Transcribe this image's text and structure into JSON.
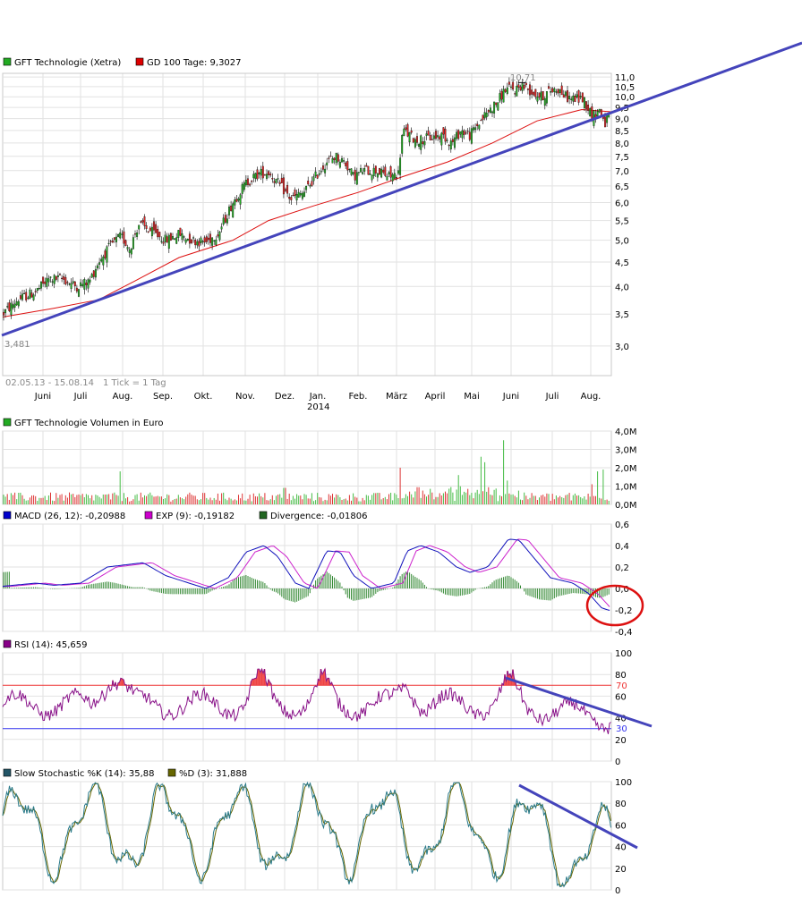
{
  "price_panel": {
    "legend": [
      {
        "label": "GFT Technologie (Xetra)",
        "color": "#22aa22"
      },
      {
        "label": "GD 100 Tage: 9,3027",
        "color": "#dd0000"
      }
    ],
    "yticks": [
      "11,0",
      "10,5",
      "10,0",
      "9,5",
      "9,0",
      "8,5",
      "8,0",
      "7,5",
      "7,0",
      "6,5",
      "6,0",
      "5,5",
      "5,0",
      "4,5",
      "4,0",
      "3,5",
      "3,0"
    ],
    "ytick_values": [
      11,
      10.5,
      10,
      9.5,
      9,
      8.5,
      8,
      7.5,
      7,
      6.5,
      6,
      5.5,
      5,
      4.5,
      4,
      3.5,
      3
    ],
    "high_label": "10,71",
    "low_label": "3,481",
    "date_range": "02.05.13 - 15.08.14",
    "tick_info": "1 Tick = 1 Tag",
    "months": [
      "Juni",
      "Juli",
      "Aug.",
      "Sep.",
      "Okt.",
      "Nov.",
      "Dez.",
      "Jan.",
      "Feb.",
      "März",
      "April",
      "Mai",
      "Juni",
      "Juli",
      "Aug."
    ],
    "year_label": "2014"
  },
  "volume_panel": {
    "legend": [
      {
        "label": "GFT Technologie Volumen in Euro",
        "color": "#22aa22"
      }
    ],
    "yticks": [
      "4,0M",
      "3,0M",
      "2,0M",
      "1,0M",
      "0,0M"
    ]
  },
  "macd_panel": {
    "legend": [
      {
        "label": "MACD (26, 12): -0,20988",
        "color": "#0000cc"
      },
      {
        "label": "EXP (9): -0,19182",
        "color": "#cc00cc"
      },
      {
        "label": "Divergence: -0,01806",
        "color": "#226622"
      }
    ],
    "yticks": [
      "0,6",
      "0,4",
      "0,2",
      "0,0",
      "-0,2",
      "-0,4"
    ]
  },
  "rsi_panel": {
    "legend": [
      {
        "label": "RSI (14): 45,659",
        "color": "#880088"
      }
    ],
    "yticks": [
      "100",
      "80",
      "60",
      "40",
      "20",
      "0"
    ],
    "level_70": "70",
    "level_30": "30"
  },
  "stoch_panel": {
    "legend": [
      {
        "label": "Slow Stochastic %K (14): 35,88",
        "color": "#225566"
      },
      {
        "label": "%D (3): 31,888",
        "color": "#666600"
      }
    ],
    "yticks": [
      "100",
      "80",
      "60",
      "40",
      "20",
      "0"
    ]
  },
  "chart_data": [
    {
      "type": "candlestick",
      "title": "GFT Technologie (Xetra)",
      "x": [
        "2013-05",
        "2013-06",
        "2013-07",
        "2013-08",
        "2013-09",
        "2013-10",
        "2013-11",
        "2013-12",
        "2014-01",
        "2014-02",
        "2014-03",
        "2014-04",
        "2014-05",
        "2014-06",
        "2014-07",
        "2014-08"
      ],
      "close_approx": [
        3.6,
        3.9,
        4.1,
        5.3,
        5.0,
        5.0,
        6.9,
        6.2,
        7.4,
        6.8,
        8.3,
        8.1,
        9.0,
        10.6,
        10.3,
        9.3
      ],
      "series": [
        {
          "name": "GD 100 Tage",
          "last": 9.3027
        }
      ],
      "high": 10.71,
      "low": 3.481,
      "ylim": [
        2.6,
        11.2
      ],
      "yscale": "log",
      "trendline": {
        "from": [
          "2013-05",
          3.48
        ],
        "to": [
          "2014-08",
          9.1
        ]
      }
    },
    {
      "type": "bar",
      "title": "GFT Technologie Volumen in Euro",
      "ylim": [
        0,
        4
      ],
      "unit": "M",
      "max_approx": 3.5
    },
    {
      "type": "line",
      "series": [
        {
          "name": "MACD (26, 12)",
          "last": -0.20988
        },
        {
          "name": "EXP (9)",
          "last": -0.19182
        },
        {
          "name": "Divergence",
          "last": -0.01806
        }
      ],
      "ylim": [
        -0.4,
        0.6
      ],
      "peaks_approx": [
        [
          "2013-07",
          0.25
        ],
        [
          "2013-11",
          0.4
        ],
        [
          "2014-01",
          0.35
        ],
        [
          "2014-03",
          0.38
        ],
        [
          "2014-06",
          0.45
        ],
        [
          "2014-08",
          -0.21
        ]
      ]
    },
    {
      "type": "line",
      "series": [
        {
          "name": "RSI (14)",
          "last": 45.659
        }
      ],
      "ylim": [
        0,
        100
      ],
      "levels": [
        70,
        30
      ]
    },
    {
      "type": "line",
      "series": [
        {
          "name": "Slow Stochastic %K (14)",
          "last": 35.88
        },
        {
          "name": "%D (3)",
          "last": 31.888
        }
      ],
      "ylim": [
        0,
        100
      ]
    }
  ]
}
